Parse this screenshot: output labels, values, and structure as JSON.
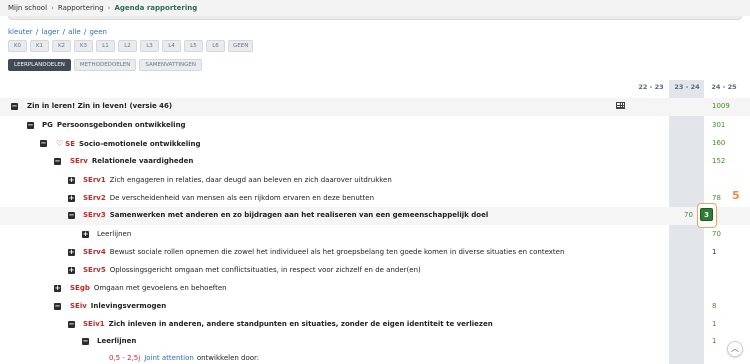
{
  "breadcrumb": {
    "items": [
      "Mijn school",
      "Rapportering"
    ],
    "current": "Agenda rapportering"
  },
  "filters": {
    "links": [
      "kleuter",
      "lager",
      "alle",
      "geen"
    ],
    "levels": [
      "K0",
      "K1",
      "K2",
      "K3",
      "L1",
      "L2",
      "L3",
      "L4",
      "L5",
      "L6",
      "GEEN"
    ]
  },
  "view_tabs": {
    "items": [
      "LEERPLANDOELEN",
      "METHODEDOELEN",
      "SAMENVATTINGEN"
    ],
    "active": "LEERPLANDOELEN"
  },
  "columns": [
    "22 - 23",
    "23 - 24",
    "24 - 25"
  ],
  "rows": [
    {
      "toggle": "−",
      "code": "",
      "label": "Zin in leren! Zin in leven! (versie 46)",
      "bold": true,
      "value": "1009",
      "icon": "table-icon"
    },
    {
      "toggle": "−",
      "code": "PG",
      "label": "Persoonsgebonden ontwikkeling",
      "bold": true,
      "value": "301"
    },
    {
      "toggle": "−",
      "code": "SE",
      "label": "Socio-emotionele ontwikkeling",
      "bold": true,
      "value": "160",
      "icon": "heart-icon"
    },
    {
      "toggle": "−",
      "code": "SErv",
      "label": "Relationele vaardigheden",
      "bold": true,
      "value": "152"
    },
    {
      "toggle": "+",
      "code": "SErv1",
      "label": "Zich engageren in relaties, daar deugd aan beleven en zich daarover uitdrukken",
      "bold": false,
      "value": ""
    },
    {
      "toggle": "+",
      "code": "SErv2",
      "label": "De verscheidenheid van mensen als een rijkdom ervaren en deze benutten",
      "bold": false,
      "value": "78"
    },
    {
      "toggle": "−",
      "code": "SErv3",
      "label": "Samenwerken met anderen en zo bijdragen aan het realiseren van een gemeenschappelijk doel",
      "bold": true,
      "value0": "70",
      "value": "3"
    },
    {
      "toggle": "+",
      "code": "",
      "label": "Leerlijnen",
      "bold": false,
      "value0": "70",
      "value": ""
    },
    {
      "toggle": "+",
      "code": "SErv4",
      "label": "Bewust sociale rollen opnemen die zowel het individueel als het groepsbelang ten goede komen in diverse situaties en contexten",
      "bold": false,
      "value": "1"
    },
    {
      "toggle": "+",
      "code": "SErv5",
      "label": "Oplossingsgericht omgaan met conflictsituaties, in respect voor zichzelf en de ander(en)",
      "bold": false,
      "value": ""
    },
    {
      "toggle": "+",
      "code": "SEgb",
      "label": "Omgaan met gevoelens en behoeften",
      "bold": false,
      "value": ""
    },
    {
      "toggle": "−",
      "code": "SEiv",
      "label": "Inlevingsvermogen",
      "bold": true,
      "value": "8"
    },
    {
      "toggle": "−",
      "code": "SEiv1",
      "label": "Zich inleven in anderen, andere standpunten en situaties, zonder de eigen identiteit te verliezen",
      "bold": true,
      "value": "1"
    },
    {
      "toggle": "−",
      "code": "",
      "label": "Leerlijnen",
      "bold": true,
      "value": "1"
    },
    {
      "toggle": "",
      "range": "0,5 - 2,5j",
      "link": "Joint attention",
      "label": "ontwikkelen door:",
      "bold": false,
      "value": ""
    }
  ],
  "badge": {
    "value": "3",
    "annotation": "5"
  },
  "colors": {
    "accent_green": "#3f8f2e",
    "code_red": "#c62828",
    "link_blue": "#2a6eb5",
    "badge_orange": "#f08a3c"
  }
}
